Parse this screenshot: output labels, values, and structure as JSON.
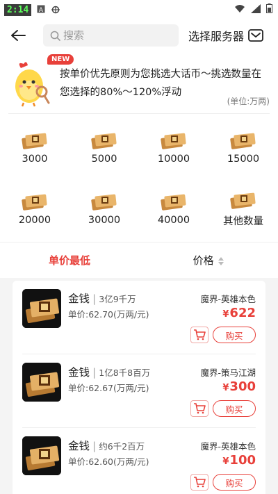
{
  "status_bar": {
    "time": "2:14",
    "icons": [
      "notification-a-icon",
      "bug-icon",
      "wifi-icon",
      "signal-icon",
      "battery-icon"
    ]
  },
  "header": {
    "search_placeholder": "搜索",
    "server_label": "选择服务器"
  },
  "notice": {
    "badge": "NEW",
    "text": "按单价优先原则为您挑选大话币～挑选数量在您选择的80%～120%浮动",
    "unit": "(单位:万两)"
  },
  "amounts": [
    {
      "label": "3000"
    },
    {
      "label": "5000"
    },
    {
      "label": "10000"
    },
    {
      "label": "15000"
    },
    {
      "label": "20000"
    },
    {
      "label": "30000"
    },
    {
      "label": "40000"
    },
    {
      "label": "其他数量"
    }
  ],
  "sort": {
    "tab_lowest": "单价最低",
    "tab_price": "价格"
  },
  "listings": [
    {
      "name": "金钱",
      "sep": "|",
      "qty": "3亿9千万",
      "unit_price": "单价:62.70(万两/元)",
      "server": "魔界-英雄本色",
      "currency": "¥",
      "price": "622",
      "buy": "购买"
    },
    {
      "name": "金钱",
      "sep": "|",
      "qty": "1亿8千8百万",
      "unit_price": "单价:62.67(万两/元)",
      "server": "魔界-策马江湖",
      "currency": "¥",
      "price": "300",
      "buy": "购买"
    },
    {
      "name": "金钱",
      "sep": "|",
      "qty": "约6千2百万",
      "unit_price": "单价:62.60(万两/元)",
      "server": "魔界-英雄本色",
      "currency": "¥",
      "price": "100",
      "buy": "购买"
    }
  ],
  "colors": {
    "accent": "#e8403a",
    "background": "#f4f4f4"
  }
}
